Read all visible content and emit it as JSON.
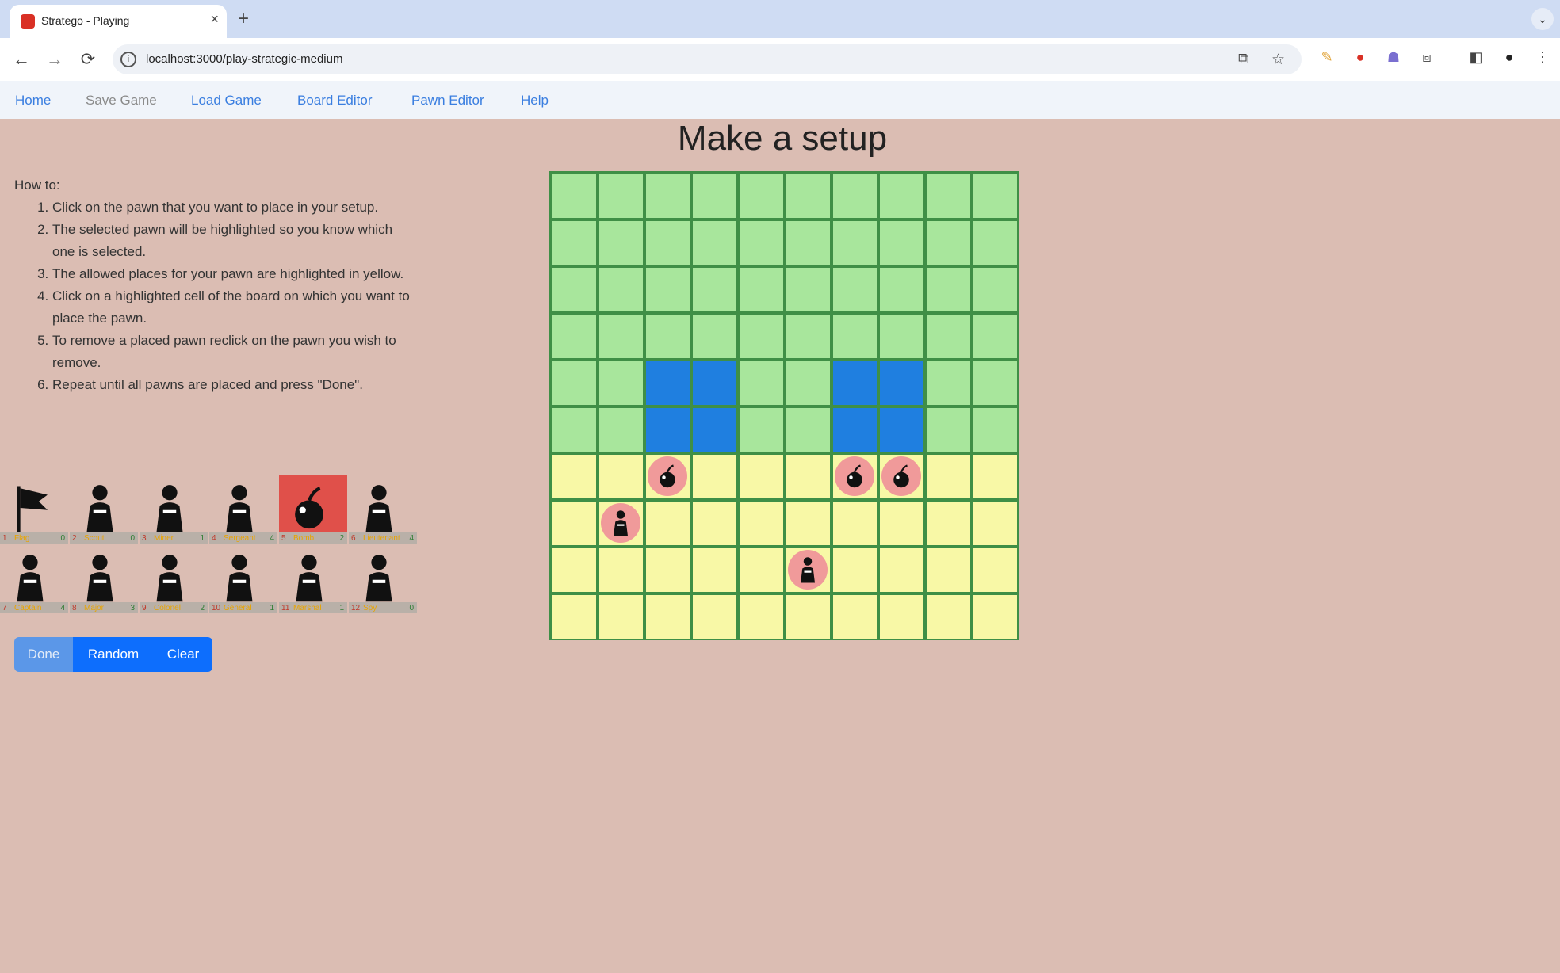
{
  "browser": {
    "tab_title": "Stratego - Playing",
    "tab_close": "×",
    "new_tab": "+",
    "url": "localhost:3000/play-strategic-medium",
    "back": "←",
    "forward": "→",
    "reload": "⟳"
  },
  "nav": {
    "items": [
      {
        "label": "Home",
        "enabled": true
      },
      {
        "label": "Save Game",
        "enabled": false
      },
      {
        "label": "Load Game",
        "enabled": true
      },
      {
        "label": "Board Editor",
        "enabled": true
      },
      {
        "label": "Pawn Editor",
        "enabled": true
      },
      {
        "label": "Help",
        "enabled": true
      }
    ]
  },
  "page": {
    "title": "Make a setup"
  },
  "howto": {
    "heading": "How to:",
    "steps": [
      "Click on the pawn that you want to place in your setup.",
      "The selected pawn will be highlighted so you know which one is selected.",
      "The allowed places for your pawn are highlighted in yellow.",
      "Click on a highlighted cell of the board on which you want to place the pawn.",
      "To remove a placed pawn reclick on the pawn you wish to remove.",
      "Repeat until all pawns are placed and press \"Done\"."
    ]
  },
  "palette": {
    "selected_index": 4,
    "pawns": [
      {
        "icon": "flag-icon",
        "rank": "1",
        "name": "Flag",
        "count": "0"
      },
      {
        "icon": "spy-icon",
        "rank": "2",
        "name": "Scout",
        "count": "0"
      },
      {
        "icon": "scout-icon",
        "rank": "3",
        "name": "Miner",
        "count": "1"
      },
      {
        "icon": "miner-icon",
        "rank": "4",
        "name": "Sergeant",
        "count": "4"
      },
      {
        "icon": "bomb-icon",
        "rank": "5",
        "name": "Bomb",
        "count": "2"
      },
      {
        "icon": "sergeant-icon",
        "rank": "6",
        "name": "Lieutenant",
        "count": "4"
      },
      {
        "icon": "lieutenant-icon",
        "rank": "7",
        "name": "Captain",
        "count": "4"
      },
      {
        "icon": "captain-icon",
        "rank": "8",
        "name": "Major",
        "count": "3"
      },
      {
        "icon": "major-icon",
        "rank": "9",
        "name": "Colonel",
        "count": "2"
      },
      {
        "icon": "colonel-icon",
        "rank": "10",
        "name": "General",
        "count": "1"
      },
      {
        "icon": "general-icon",
        "rank": "11",
        "name": "Marshal",
        "count": "1"
      },
      {
        "icon": "marshal-icon",
        "rank": "12",
        "name": "Spy",
        "count": "0"
      }
    ]
  },
  "buttons": {
    "done": "Done",
    "random": "Random",
    "clear": "Clear"
  },
  "board": {
    "rows": 10,
    "cols": 10,
    "water_cells": [
      [
        4,
        2
      ],
      [
        4,
        3
      ],
      [
        5,
        2
      ],
      [
        5,
        3
      ],
      [
        4,
        6
      ],
      [
        4,
        7
      ],
      [
        5,
        6
      ],
      [
        5,
        7
      ]
    ],
    "setup_rows_start": 6,
    "placed_pawns": [
      {
        "row": 6,
        "col": 2,
        "icon": "bomb-icon"
      },
      {
        "row": 6,
        "col": 6,
        "icon": "bomb-icon"
      },
      {
        "row": 6,
        "col": 7,
        "icon": "bomb-icon"
      },
      {
        "row": 7,
        "col": 1,
        "icon": "sergeant-icon"
      },
      {
        "row": 8,
        "col": 5,
        "icon": "scout-icon"
      }
    ]
  },
  "colors": {
    "background": "#dbbdb3",
    "land": "#a8e69c",
    "water": "#1f7fe0",
    "setup_zone": "#f8f8a6",
    "placed_pawn": "#f09a9a",
    "selected_pawn": "#e0504a",
    "button": "#0d6efd"
  }
}
